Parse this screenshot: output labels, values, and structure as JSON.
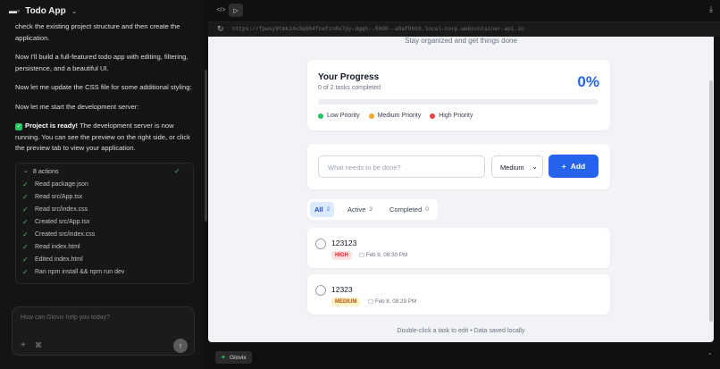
{
  "header": {
    "logo": "bolt",
    "title": "Todo App",
    "chevron": "chevron-down-icon"
  },
  "chat": {
    "msg1": "check the existing project structure and then create the application.",
    "msg2": "Now I'll build a full-featured todo app with editing, filtering, persistence, and a beautiful UI.",
    "msg3": "Now let me update the CSS file for some additional styling:",
    "msg4": "Now let me start the development server:",
    "ready_bold": "Project is ready!",
    "ready_text": " The development server is now running. You can see the preview on the right side, or click the preview tab to view your application.",
    "actions_title": "8 actions",
    "actions": [
      "Read package.json",
      "Read src/App.tsx",
      "Read src/index.css",
      "Created src/App.tsx",
      "Created src/index.css",
      "Read index.html",
      "Edited index.html",
      "Ran npm install && npm run dev"
    ]
  },
  "input": {
    "placeholder": "How can Glovix help you today?"
  },
  "preview": {
    "url": "https://fpwsy9tmk14x3q684fcefzn8x7py-dgqh--5000--a8af0bb3.local-corp.webcontainer-api.io",
    "subtitle": "Stay organized and get things done",
    "progress": {
      "title": "Your Progress",
      "sub": "0 of 2 tasks completed",
      "percent_label": "0%",
      "fraction": 0,
      "legend": [
        {
          "label": "Low Priority",
          "color": "#22c55e"
        },
        {
          "label": "Medium Priority",
          "color": "#f5a623"
        },
        {
          "label": "High Priority",
          "color": "#ef4444"
        }
      ]
    },
    "new_task": {
      "placeholder": "What needs to be done?",
      "priority": "Medium",
      "add_label": "Add"
    },
    "tabs": [
      {
        "label": "All",
        "count": "2"
      },
      {
        "label": "Active",
        "count": "2"
      },
      {
        "label": "Completed",
        "count": "0"
      }
    ],
    "tasks": [
      {
        "title": "123123",
        "priority": "HIGH",
        "date": "Feb 8, 08:30 PM"
      },
      {
        "title": "12323",
        "priority": "MEDIUM",
        "date": "Feb 8, 08:29 PM"
      }
    ],
    "footer": "Double-click a task to edit • Data saved locally"
  },
  "bottom": {
    "tab_label": "Glovix"
  }
}
